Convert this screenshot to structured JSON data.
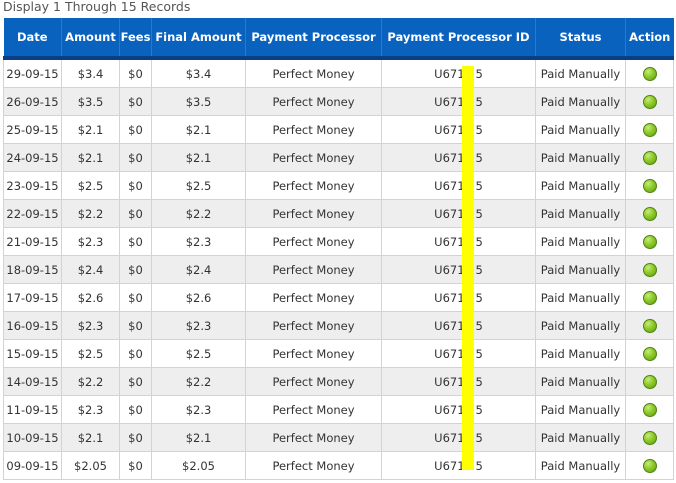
{
  "caption": "Display 1 Through 15 Records",
  "columns": [
    "Date",
    "Amount",
    "Fees",
    "Final Amount",
    "Payment Processor",
    "Payment Processor ID",
    "Status",
    "Action"
  ],
  "rows": [
    {
      "date": "29-09-15",
      "amount": "$3.4",
      "fees": "$0",
      "final": "$3.4",
      "processor": "Perfect Money",
      "processor_id": "U6719   5",
      "status": "Paid Manually"
    },
    {
      "date": "26-09-15",
      "amount": "$3.5",
      "fees": "$0",
      "final": "$3.5",
      "processor": "Perfect Money",
      "processor_id": "U6719   5",
      "status": "Paid Manually"
    },
    {
      "date": "25-09-15",
      "amount": "$2.1",
      "fees": "$0",
      "final": "$2.1",
      "processor": "Perfect Money",
      "processor_id": "U6719   5",
      "status": "Paid Manually"
    },
    {
      "date": "24-09-15",
      "amount": "$2.1",
      "fees": "$0",
      "final": "$2.1",
      "processor": "Perfect Money",
      "processor_id": "U6719   5",
      "status": "Paid Manually"
    },
    {
      "date": "23-09-15",
      "amount": "$2.5",
      "fees": "$0",
      "final": "$2.5",
      "processor": "Perfect Money",
      "processor_id": "U6719   5",
      "status": "Paid Manually"
    },
    {
      "date": "22-09-15",
      "amount": "$2.2",
      "fees": "$0",
      "final": "$2.2",
      "processor": "Perfect Money",
      "processor_id": "U6719   5",
      "status": "Paid Manually"
    },
    {
      "date": "21-09-15",
      "amount": "$2.3",
      "fees": "$0",
      "final": "$2.3",
      "processor": "Perfect Money",
      "processor_id": "U6719   5",
      "status": "Paid Manually"
    },
    {
      "date": "18-09-15",
      "amount": "$2.4",
      "fees": "$0",
      "final": "$2.4",
      "processor": "Perfect Money",
      "processor_id": "U6719   5",
      "status": "Paid Manually"
    },
    {
      "date": "17-09-15",
      "amount": "$2.6",
      "fees": "$0",
      "final": "$2.6",
      "processor": "Perfect Money",
      "processor_id": "U6719   5",
      "status": "Paid Manually"
    },
    {
      "date": "16-09-15",
      "amount": "$2.3",
      "fees": "$0",
      "final": "$2.3",
      "processor": "Perfect Money",
      "processor_id": "U6719   5",
      "status": "Paid Manually"
    },
    {
      "date": "15-09-15",
      "amount": "$2.5",
      "fees": "$0",
      "final": "$2.5",
      "processor": "Perfect Money",
      "processor_id": "U6719   5",
      "status": "Paid Manually"
    },
    {
      "date": "14-09-15",
      "amount": "$2.2",
      "fees": "$0",
      "final": "$2.2",
      "processor": "Perfect Money",
      "processor_id": "U6719   5",
      "status": "Paid Manually"
    },
    {
      "date": "11-09-15",
      "amount": "$2.3",
      "fees": "$0",
      "final": "$2.3",
      "processor": "Perfect Money",
      "processor_id": "U6719   5",
      "status": "Paid Manually"
    },
    {
      "date": "10-09-15",
      "amount": "$2.1",
      "fees": "$0",
      "final": "$2.1",
      "processor": "Perfect Money",
      "processor_id": "U6719   5",
      "status": "Paid Manually"
    },
    {
      "date": "09-09-15",
      "amount": "$2.05",
      "fees": "$0",
      "final": "$2.05",
      "processor": "Perfect Money",
      "processor_id": "U6719   5",
      "status": "Paid Manually"
    }
  ],
  "action_icon": "green-status-dot-icon",
  "colors": {
    "header_bg": "#0a62bf",
    "header_border": "#0a3f86",
    "row_alt": "#eeeeee",
    "action_dot": "#8fc92a",
    "redaction": "#ffff00"
  }
}
